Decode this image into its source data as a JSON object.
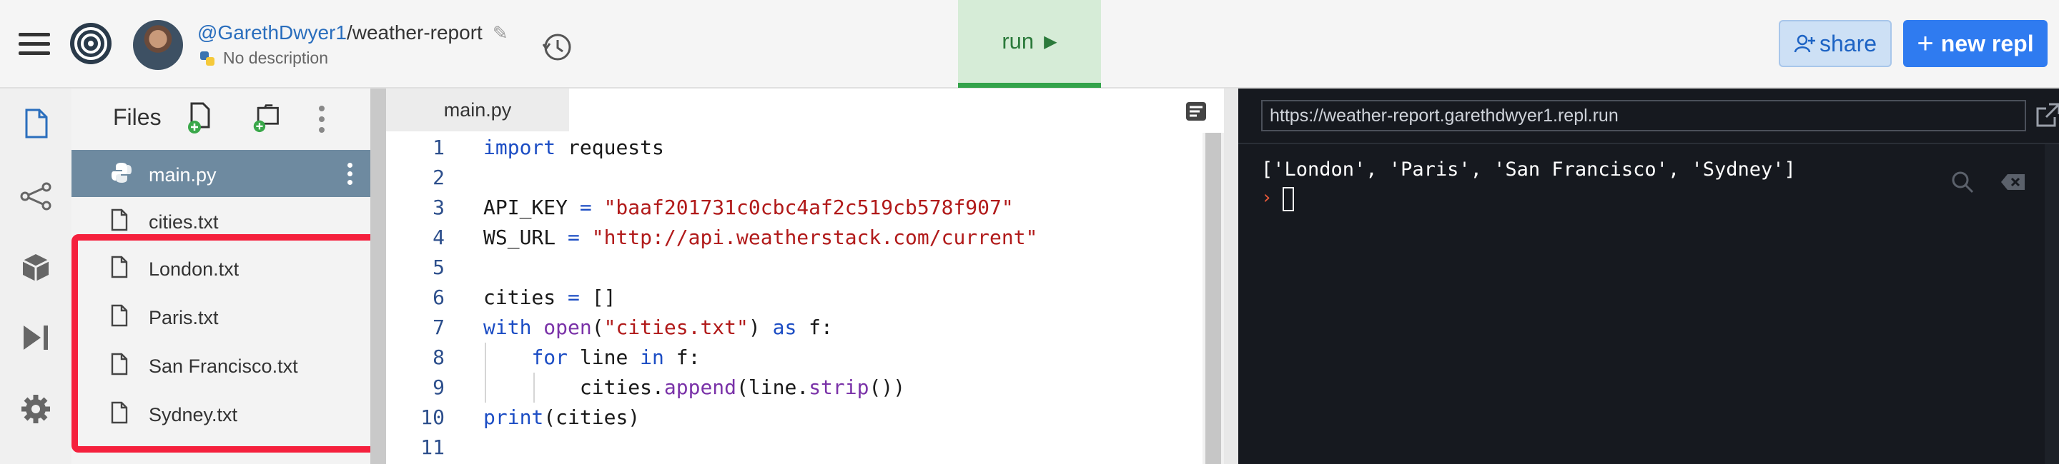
{
  "header": {
    "repo_owner": "@GarethDwyer1",
    "repo_sep": "/",
    "repo_name": "weather-report",
    "description": "No description",
    "run_label": "run",
    "share_label": "share",
    "new_label": "new repl"
  },
  "sidebar": {
    "icons": [
      "files-icon",
      "share-network-icon",
      "packages-icon",
      "debugger-icon",
      "settings-icon"
    ]
  },
  "files": {
    "title": "Files",
    "items": [
      {
        "name": "main.py",
        "active": true
      },
      {
        "name": "cities.txt"
      },
      {
        "name": "London.txt"
      },
      {
        "name": "Paris.txt"
      },
      {
        "name": "San Francisco.txt"
      },
      {
        "name": "Sydney.txt"
      }
    ]
  },
  "editor": {
    "tab": "main.py",
    "line_numbers": [
      "1",
      "2",
      "3",
      "4",
      "5",
      "6",
      "7",
      "8",
      "9",
      "10",
      "11"
    ],
    "lines": [
      "import requests",
      "",
      "API_KEY = \"baaf201731c0cbc4af2c519cb578f907\"",
      "WS_URL = \"http://api.weatherstack.com/current\"",
      "",
      "cities = []",
      "with open(\"cities.txt\") as f:",
      "    for line in f:",
      "        cities.append(line.strip())",
      "print(cities)",
      ""
    ]
  },
  "console": {
    "url": "https://weather-report.garethdwyer1.repl.run",
    "output": "['London', 'Paris', 'San Francisco', 'Sydney']",
    "prompt": "›"
  },
  "colors": {
    "run_bg": "#d6ecd7",
    "run_accent": "#33a34a",
    "share_bg": "#cde0f5",
    "new_repl_bg": "#2f7bf0",
    "highlight_border": "#f5203d",
    "console_bg": "#16191f"
  }
}
